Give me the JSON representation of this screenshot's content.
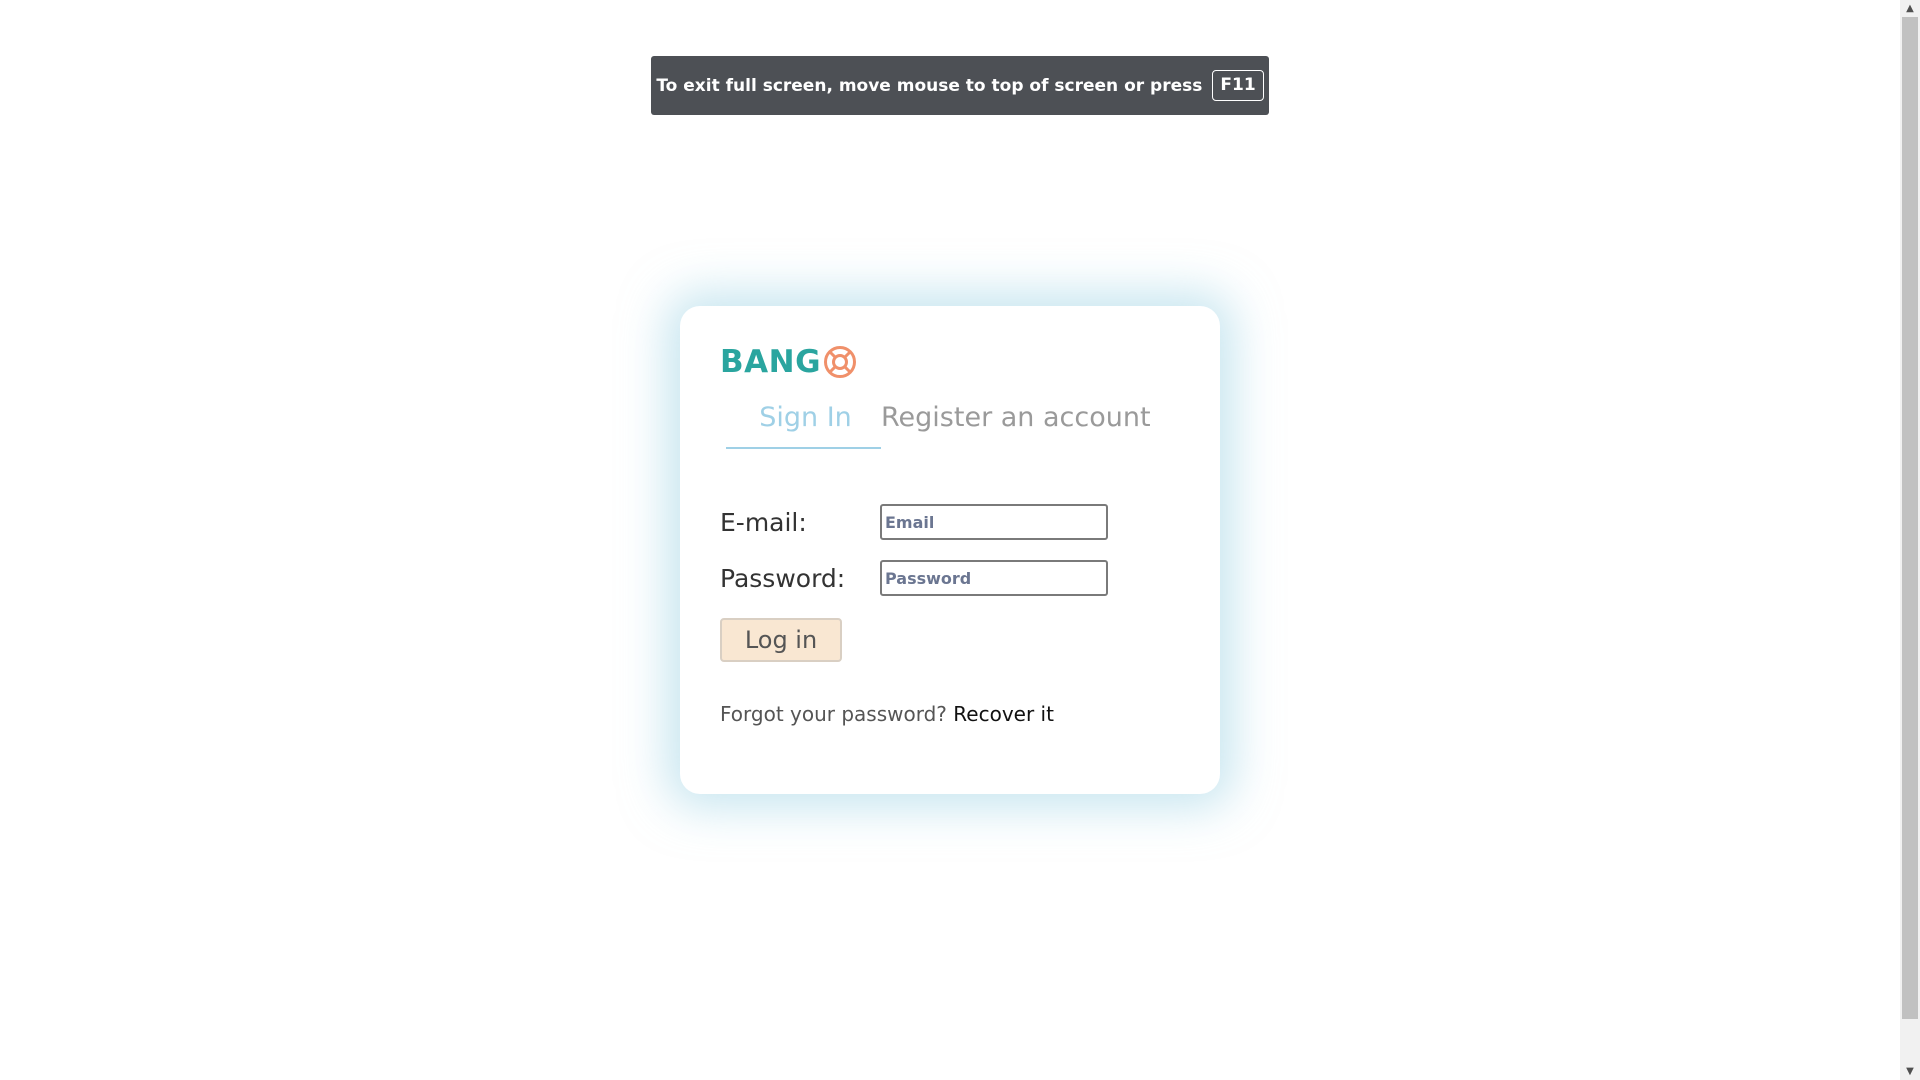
{
  "fullscreen_notice": {
    "message": "To exit full screen, move mouse to top of screen or press",
    "key": "F11"
  },
  "brand": {
    "name": "BANG",
    "icon": "lifebuoy-icon",
    "text_color": "#2aa59f",
    "icon_color": "#f0906a"
  },
  "tabs": [
    {
      "label": "Sign In",
      "active": true
    },
    {
      "label": "Register an account",
      "active": false
    }
  ],
  "form": {
    "email": {
      "label": "E-mail:",
      "placeholder": "Email",
      "value": ""
    },
    "password": {
      "label": "Password:",
      "placeholder": "Password",
      "value": ""
    },
    "submit_label": "Log in"
  },
  "recovery": {
    "prompt": "Forgot your password?",
    "link": "Recover it"
  },
  "scrollbar": {
    "up_arrow": "▲",
    "down_arrow": "▼"
  }
}
